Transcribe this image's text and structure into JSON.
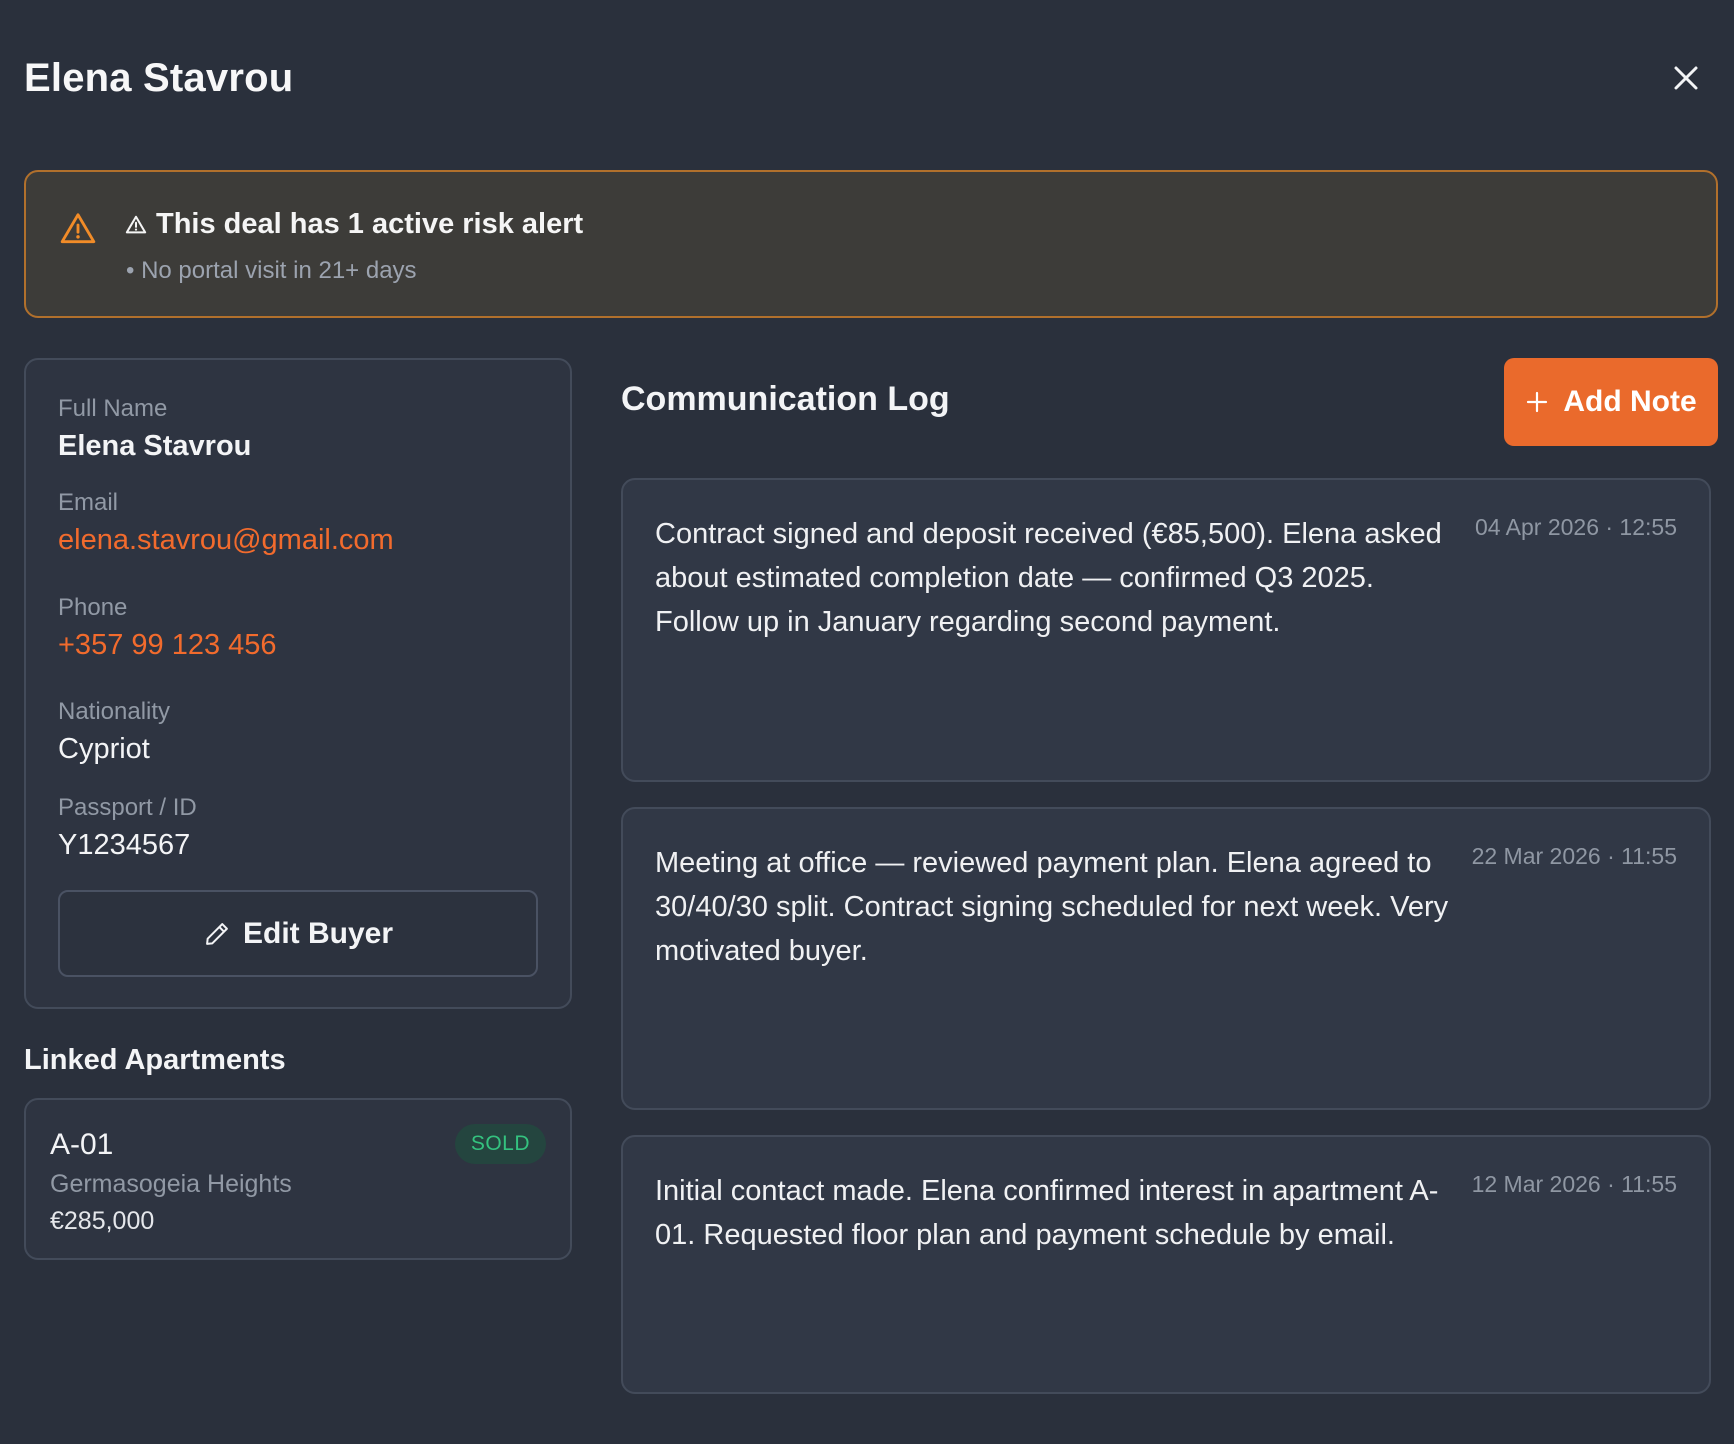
{
  "header": {
    "title": "Elena Stavrou",
    "close_icon": "close-icon"
  },
  "alert": {
    "title": "This deal has 1 active risk alert",
    "items": [
      "• No portal visit in 21+ days"
    ],
    "accent_color": "#f28c28",
    "icon": "warning-triangle-icon"
  },
  "buyer": {
    "fields": [
      {
        "label": "Full Name",
        "value": "Elena Stavrou"
      },
      {
        "label": "Email",
        "value": "elena.stavrou@gmail.com"
      },
      {
        "label": "Phone",
        "value": "+357 99 123 456"
      },
      {
        "label": "Nationality",
        "value": "Cypriot"
      },
      {
        "label": "Passport / ID",
        "value": "Y1234567"
      }
    ],
    "edit_label": "Edit Buyer",
    "link_color": "#f26b2d"
  },
  "linked": {
    "title": "Linked Apartments",
    "apartments": [
      {
        "code": "A-01",
        "project": "Germasogeia Heights",
        "price": "€285,000",
        "status": "SOLD"
      }
    ]
  },
  "log": {
    "title": "Communication Log",
    "add_label": "Add Note",
    "notes": [
      {
        "text": "Contract signed and deposit received (€85,500). Elena asked about estimated completion date — confirmed Q3 2025. Follow up in January regarding second payment.",
        "time": "04 Apr 2026 · 12:55"
      },
      {
        "text": "Meeting at office — reviewed payment plan. Elena agreed to 30/40/30 split. Contract signing scheduled for next week. Very motivated buyer.",
        "time": "22 Mar 2026 · 11:55"
      },
      {
        "text": "Initial contact made. Elena confirmed interest in apartment A-01. Requested floor plan and payment schedule by email.",
        "time": "12 Mar 2026 · 11:55"
      }
    ]
  },
  "colors": {
    "background": "#2a303c",
    "primary": "#ea6a2c",
    "status_sold": "#34c27f"
  }
}
